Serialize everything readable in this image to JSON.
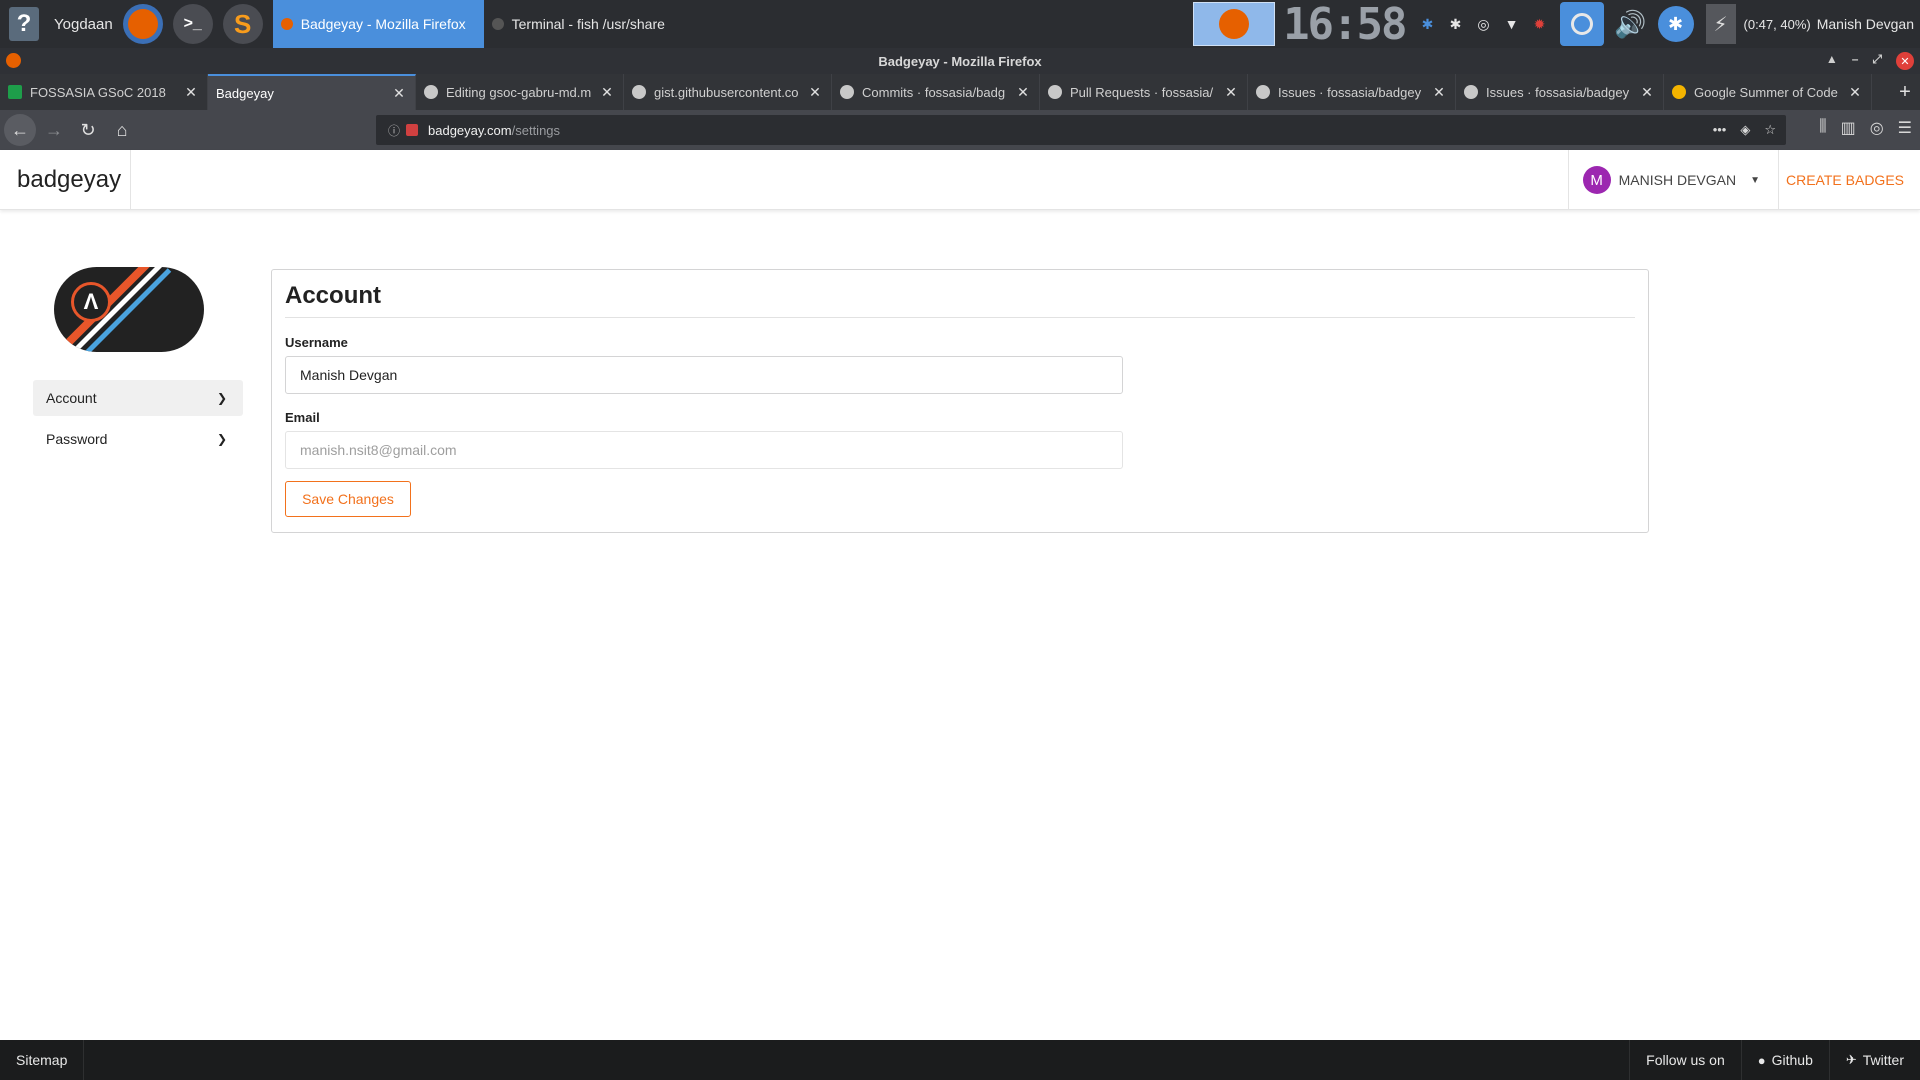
{
  "taskbar": {
    "launcher_user": "Yogdaan",
    "tasks": [
      {
        "label": "Badgeyay - Mozilla Firefox",
        "active": true
      },
      {
        "label": "Terminal - fish  /usr/share",
        "active": false
      }
    ],
    "clock": "16:58",
    "battery": "(0:47, 40%)",
    "user": "Manish Devgan"
  },
  "window": {
    "title": "Badgeyay - Mozilla Firefox"
  },
  "tabs": [
    {
      "title": "FOSSASIA GSoC 2018"
    },
    {
      "title": "Badgeyay",
      "active": true
    },
    {
      "title": "Editing gsoc-gabru-md.m"
    },
    {
      "title": "gist.githubusercontent.co"
    },
    {
      "title": "Commits · fossasia/badg"
    },
    {
      "title": "Pull Requests · fossasia/"
    },
    {
      "title": "Issues · fossasia/badgey"
    },
    {
      "title": "Issues · fossasia/badgey"
    },
    {
      "title": "Google Summer of Code"
    }
  ],
  "url": {
    "host": "badgeyay.com",
    "path": "/settings"
  },
  "site": {
    "brand": "badgeyay",
    "user_initial": "M",
    "user_name": "MANISH DEVGAN",
    "create_badges": "CREATE BADGES"
  },
  "sidebar": {
    "items": [
      {
        "label": "Account",
        "active": true
      },
      {
        "label": "Password",
        "active": false
      }
    ]
  },
  "account_form": {
    "title": "Account",
    "username_label": "Username",
    "username_value": "Manish Devgan",
    "email_label": "Email",
    "email_value": "manish.nsit8@gmail.com",
    "save_label": "Save Changes"
  },
  "footer": {
    "sitemap": "Sitemap",
    "follow": "Follow us on",
    "github": "Github",
    "twitter": "Twitter"
  },
  "colors": {
    "accent_orange": "#f2711c",
    "taskbar_active": "#4a8fdc",
    "avatar_purple": "#9c27b0"
  }
}
